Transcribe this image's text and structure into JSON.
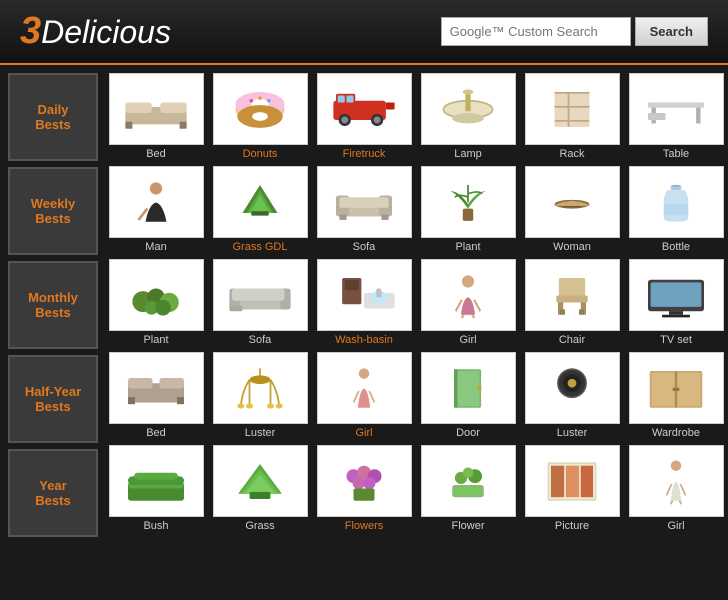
{
  "header": {
    "logo_3": "3",
    "logo_delicious": "Delicious",
    "search_placeholder": "Custom Search",
    "google_label": "Google™",
    "search_button_label": "Search"
  },
  "sidebar": {
    "items": [
      {
        "id": "daily",
        "label": "Daily\nBests",
        "class": "daily"
      },
      {
        "id": "weekly",
        "label": "Weekly\nBests",
        "class": "weekly"
      },
      {
        "id": "monthly",
        "label": "Monthly\nBests",
        "class": "monthly"
      },
      {
        "id": "halfyear",
        "label": "Half-Year\nBests",
        "class": "halfyear"
      },
      {
        "id": "year",
        "label": "Year\nBests",
        "class": "year"
      }
    ]
  },
  "rows": [
    {
      "id": "row1",
      "items": [
        {
          "label": "Bed",
          "color": "gray",
          "orange": false
        },
        {
          "label": "Donuts",
          "color": "pink",
          "orange": true
        },
        {
          "label": "Firetruck",
          "color": "red",
          "orange": true
        },
        {
          "label": "Lamp",
          "color": "yellow",
          "orange": false
        },
        {
          "label": "Rack",
          "color": "beige",
          "orange": false
        },
        {
          "label": "Table",
          "color": "gray",
          "orange": false
        }
      ]
    },
    {
      "id": "row2",
      "items": [
        {
          "label": "Man",
          "color": "brown",
          "orange": false
        },
        {
          "label": "Grass GDL",
          "color": "green",
          "orange": true
        },
        {
          "label": "Sofa",
          "color": "beige",
          "orange": false
        },
        {
          "label": "Plant",
          "color": "green",
          "orange": false
        },
        {
          "label": "Woman",
          "color": "beige",
          "orange": false
        },
        {
          "label": "Bottle",
          "color": "blue",
          "orange": false
        }
      ]
    },
    {
      "id": "row3",
      "items": [
        {
          "label": "Plant",
          "color": "green",
          "orange": false
        },
        {
          "label": "Sofa",
          "color": "gray",
          "orange": false
        },
        {
          "label": "Wash-basin",
          "color": "brown",
          "orange": true
        },
        {
          "label": "Girl",
          "color": "peach",
          "orange": false
        },
        {
          "label": "Chair",
          "color": "tan",
          "orange": false
        },
        {
          "label": "TV set",
          "color": "silver",
          "orange": false
        }
      ]
    },
    {
      "id": "row4",
      "items": [
        {
          "label": "Bed",
          "color": "gray",
          "orange": false
        },
        {
          "label": "Luster",
          "color": "gold",
          "orange": false
        },
        {
          "label": "Girl",
          "color": "pink",
          "orange": true
        },
        {
          "label": "Door",
          "color": "green",
          "orange": false
        },
        {
          "label": "Luster",
          "color": "black",
          "orange": false
        },
        {
          "label": "Wardrobe",
          "color": "tan",
          "orange": false
        }
      ]
    },
    {
      "id": "row5",
      "items": [
        {
          "label": "Bush",
          "color": "green",
          "orange": false
        },
        {
          "label": "Grass",
          "color": "green",
          "orange": false
        },
        {
          "label": "Flowers",
          "color": "purple",
          "orange": true
        },
        {
          "label": "Flower",
          "color": "green",
          "orange": false
        },
        {
          "label": "Picture",
          "color": "colorful",
          "orange": false
        },
        {
          "label": "Girl",
          "color": "peach",
          "orange": false
        }
      ]
    }
  ]
}
